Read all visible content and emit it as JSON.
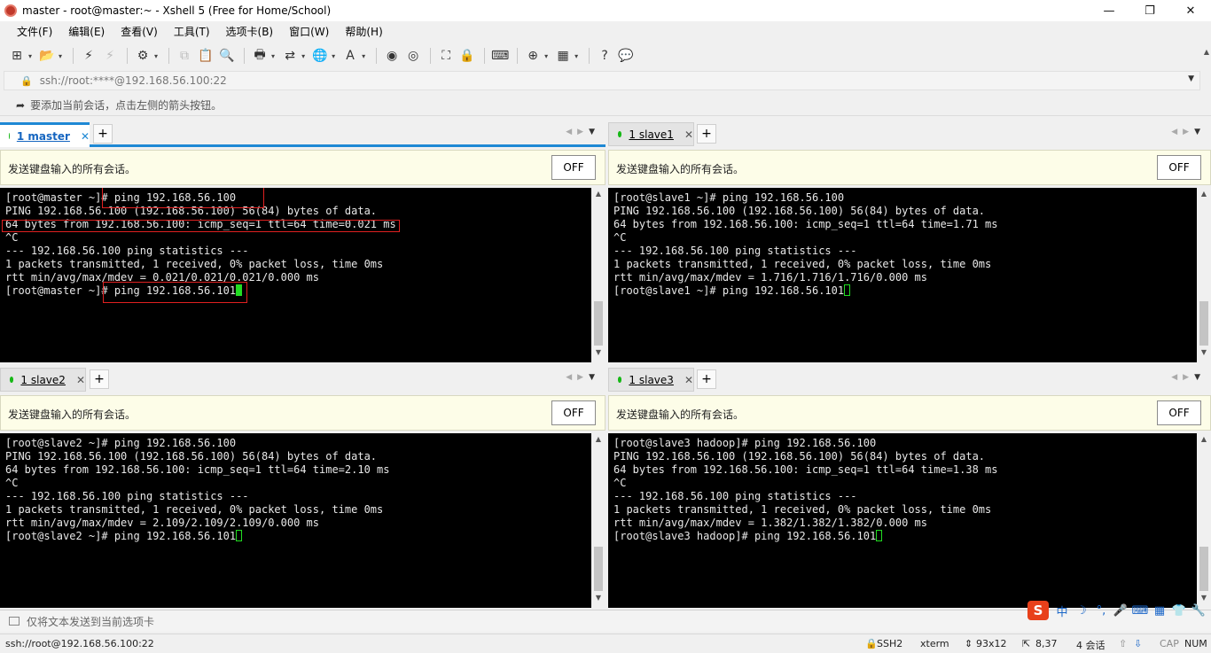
{
  "window": {
    "title": "master - root@master:~ - Xshell 5 (Free for Home/School)",
    "controls": [
      "—",
      "❐",
      "✕"
    ]
  },
  "menu": [
    "文件(F)",
    "编辑(E)",
    "查看(V)",
    "工具(T)",
    "选项卡(B)",
    "窗口(W)",
    "帮助(H)"
  ],
  "address": {
    "url": "ssh://root:****@192.168.56.100:22"
  },
  "hint": "要添加当前会话，点击左侧的箭头按钮。",
  "send_all": {
    "label": "发送键盘输入的所有会话。",
    "button": "OFF"
  },
  "panes": [
    {
      "tab": "1 master",
      "lines": [
        "[root@master ~]# ping 192.168.56.100",
        "PING 192.168.56.100 (192.168.56.100) 56(84) bytes of data.",
        "64 bytes from 192.168.56.100: icmp_seq=1 ttl=64 time=0.021 ms",
        "^C",
        "--- 192.168.56.100 ping statistics ---",
        "1 packets transmitted, 1 received, 0% packet loss, time 0ms",
        "rtt min/avg/max/mdev = 0.021/0.021/0.021/0.000 ms",
        "[root@master ~]# ping 192.168.56.101"
      ]
    },
    {
      "tab": "1 slave1",
      "lines": [
        "[root@slave1 ~]# ping 192.168.56.100",
        "PING 192.168.56.100 (192.168.56.100) 56(84) bytes of data.",
        "64 bytes from 192.168.56.100: icmp_seq=1 ttl=64 time=1.71 ms",
        "^C",
        "--- 192.168.56.100 ping statistics ---",
        "1 packets transmitted, 1 received, 0% packet loss, time 0ms",
        "rtt min/avg/max/mdev = 1.716/1.716/1.716/0.000 ms",
        "[root@slave1 ~]# ping 192.168.56.101"
      ]
    },
    {
      "tab": "1 slave2",
      "lines": [
        "[root@slave2 ~]# ping 192.168.56.100",
        "PING 192.168.56.100 (192.168.56.100) 56(84) bytes of data.",
        "64 bytes from 192.168.56.100: icmp_seq=1 ttl=64 time=2.10 ms",
        "^C",
        "--- 192.168.56.100 ping statistics ---",
        "1 packets transmitted, 1 received, 0% packet loss, time 0ms",
        "rtt min/avg/max/mdev = 2.109/2.109/2.109/0.000 ms",
        "[root@slave2 ~]# ping 192.168.56.101"
      ]
    },
    {
      "tab": "1 slave3",
      "lines": [
        "[root@slave3 hadoop]# ping 192.168.56.100",
        "PING 192.168.56.100 (192.168.56.100) 56(84) bytes of data.",
        "64 bytes from 192.168.56.100: icmp_seq=1 ttl=64 time=1.38 ms",
        "^C",
        "--- 192.168.56.100 ping statistics ---",
        "1 packets transmitted, 1 received, 0% packet loss, time 0ms",
        "rtt min/avg/max/mdev = 1.382/1.382/1.382/0.000 ms",
        "[root@slave3 hadoop]# ping 192.168.56.101"
      ]
    }
  ],
  "compose": "仅将文本发送到当前选项卡",
  "ime": {
    "logo": "S",
    "items": [
      "中",
      "☽",
      "°,",
      "🎤",
      "⌨",
      "▦",
      "👕",
      "🔧"
    ]
  },
  "status": {
    "connection": "ssh://root@192.168.56.100:22",
    "protocol": "SSH2",
    "terminal": "xterm",
    "size": "93x12",
    "position": "8,37",
    "sessions": "4 会话",
    "caps": "CAP",
    "num": "NUM"
  },
  "colors": {
    "accent": "#1e88d4",
    "cursor": "#22dd22",
    "highlight": "#e02020",
    "connected": "#16b816"
  }
}
